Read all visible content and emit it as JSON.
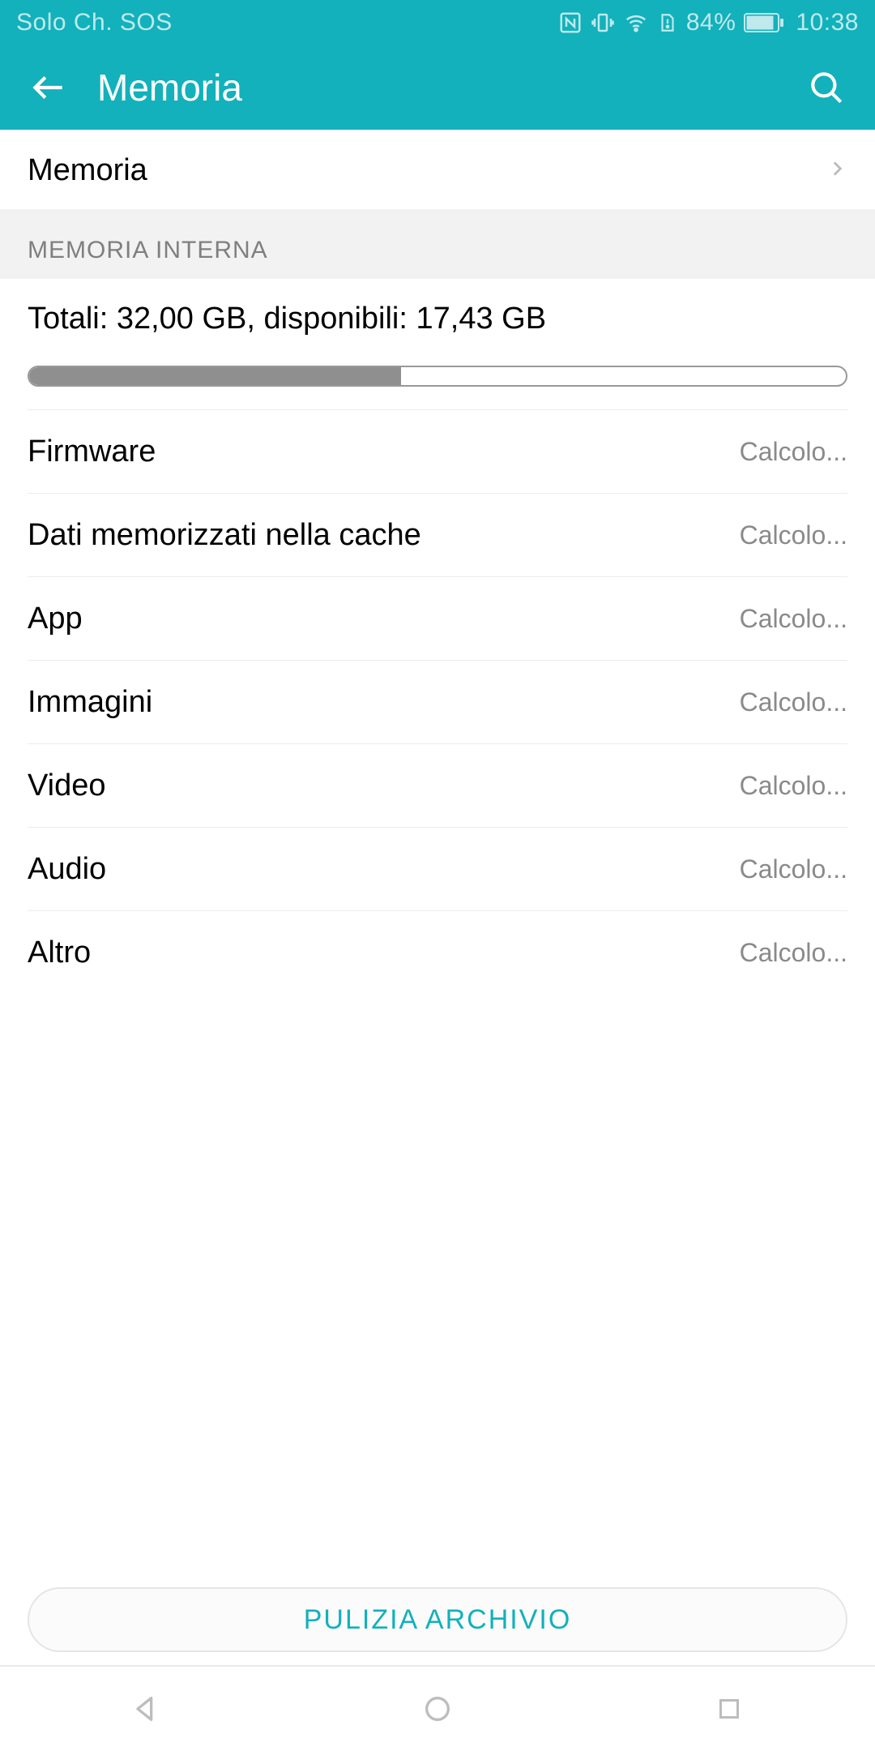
{
  "status": {
    "carrier": "Solo Ch. SOS",
    "battery_percent": "84%",
    "time": "10:38"
  },
  "appbar": {
    "title": "Memoria"
  },
  "top_row": {
    "label": "Memoria"
  },
  "section": {
    "header": "MEMORIA INTERNA"
  },
  "storage": {
    "summary": "Totali: 32,00 GB, disponibili: 17,43 GB",
    "used_percent": 45.5
  },
  "details": [
    {
      "label": "Firmware",
      "value": "Calcolo..."
    },
    {
      "label": "Dati memorizzati nella cache",
      "value": "Calcolo..."
    },
    {
      "label": "App",
      "value": "Calcolo..."
    },
    {
      "label": "Immagini",
      "value": "Calcolo..."
    },
    {
      "label": "Video",
      "value": "Calcolo..."
    },
    {
      "label": "Audio",
      "value": "Calcolo..."
    },
    {
      "label": "Altro",
      "value": "Calcolo..."
    }
  ],
  "footer": {
    "clean_button": "PULIZIA ARCHIVIO"
  },
  "colors": {
    "accent": "#12b1bb"
  }
}
